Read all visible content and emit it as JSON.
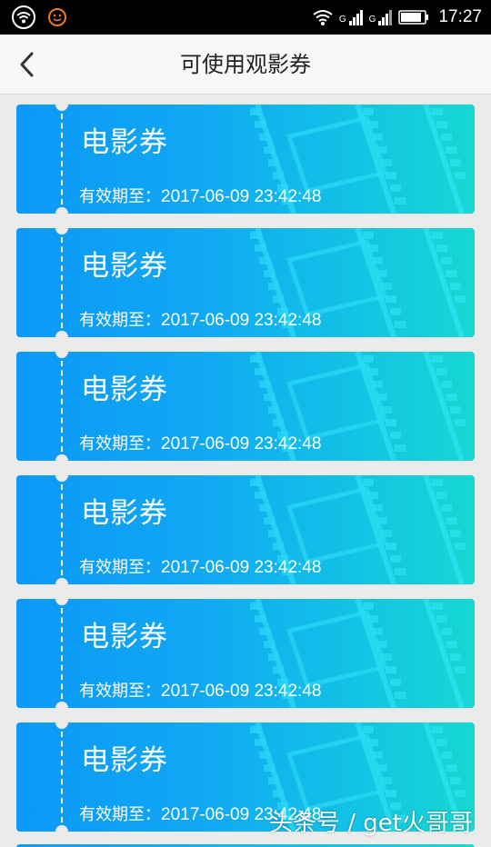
{
  "status_bar": {
    "time": "17:27",
    "signal1_label": "G",
    "signal2_label": "G",
    "icons": [
      "wifi-icon",
      "smiley-notification-icon",
      "signal-icon",
      "battery-icon"
    ]
  },
  "header": {
    "title": "可使用观影券",
    "back_icon": "chevron-left-icon"
  },
  "coupons": [
    {
      "title": "电影券",
      "expiry_label": "有效期至：",
      "expiry_date": "2017-06-09 23:42:48"
    },
    {
      "title": "电影券",
      "expiry_label": "有效期至：",
      "expiry_date": "2017-06-09 23:42:48"
    },
    {
      "title": "电影券",
      "expiry_label": "有效期至：",
      "expiry_date": "2017-06-09 23:42:48"
    },
    {
      "title": "电影券",
      "expiry_label": "有效期至：",
      "expiry_date": "2017-06-09 23:42:48"
    },
    {
      "title": "电影券",
      "expiry_label": "有效期至：",
      "expiry_date": "2017-06-09 23:42:48"
    },
    {
      "title": "电影券",
      "expiry_label": "有效期至：",
      "expiry_date": "2017-06-09 23:42:48"
    }
  ],
  "watermark": "头条号 / get火哥哥",
  "colors": {
    "coupon_gradient_start": "#0b98f7",
    "coupon_gradient_end": "#16d8d2",
    "background": "#ebebeb"
  }
}
